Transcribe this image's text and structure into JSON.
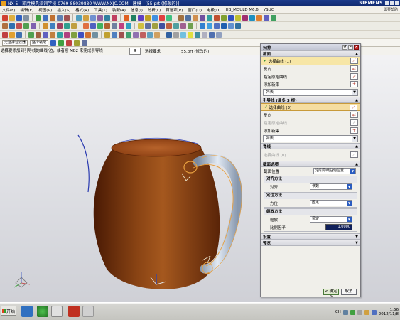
{
  "window": {
    "title": "NX 5 - 凯胜模具培训学校  0769-88039880  WWW.NXJC.COM - 建模 - [55.prt (修改的)]",
    "brand": "SIEMENS"
  },
  "menu": {
    "items": [
      "文件(F)",
      "编辑(E)",
      "视图(V)",
      "插入(S)",
      "格式(R)",
      "工具(T)",
      "装配(A)",
      "信息(I)",
      "分析(L)",
      "首选项(P)",
      "窗口(O)",
      "电极(D)",
      "HB_MOULD M6.6",
      "YSUC"
    ],
    "right": "需要帮助"
  },
  "selection_bar": {
    "filter": "整个装配",
    "mode": "无选择过滤器"
  },
  "cue_line": {
    "message": "选择要添加到引导线的曲线/边，或者按 MB2 来完成引导线",
    "status_label": "选择要求",
    "document_name": "55.prt (修改的)"
  },
  "dialog": {
    "title": "扫掠",
    "sections": {
      "section_curves": {
        "title": "截面",
        "select_curve": "选择曲线 (1)",
        "reverse": "反向",
        "specify_origin": "指定原始曲线",
        "add_new_set": "添加新集",
        "list_label": "列表"
      },
      "guides": {
        "title": "引导线 (最多 3 根)",
        "select_curve": "选择曲线 (3)",
        "reverse": "反向",
        "specify_origin": "指定原始曲线",
        "add_new_set": "添加新集",
        "list_label": "列表"
      },
      "spine": {
        "title": "脊线",
        "select_curve": "选择曲线 (0)"
      },
      "section_options": {
        "title": "截面选项",
        "section_location_label": "截面位置",
        "section_location_value": "沿引导线任何位置",
        "alignment_method": {
          "title": "对齐方法",
          "align_label": "对齐",
          "align_value": "参数"
        },
        "orientation_method": {
          "title": "定位方法",
          "orientation_label": "方位",
          "orientation_value": "固定"
        },
        "scaling_method": {
          "title": "缩放方法",
          "scaling_label": "缩放",
          "scaling_value": "恒定",
          "scale_factor_label": "比例因子",
          "scale_factor_value": "1.0000"
        }
      },
      "settings": {
        "title": "设置"
      },
      "preview": {
        "title": "预览"
      }
    },
    "ok_label": "< 确定 >",
    "cancel_label": "取消"
  },
  "taskbar": {
    "start_label": "开始",
    "language": "CH",
    "time": "1:56",
    "date": "2012/11/8"
  },
  "colors": {
    "mug_body": "#7a3a10",
    "mug_rim": "#a0521c",
    "handle": "#c8d4e4",
    "guide_curve": "#e8a040",
    "section_curve": "#2a3ab0"
  }
}
